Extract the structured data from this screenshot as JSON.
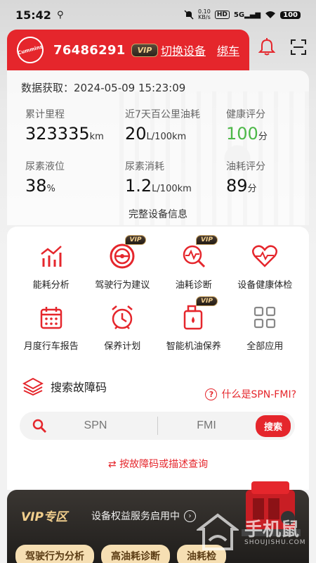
{
  "status_bar": {
    "time": "15:42",
    "usb_icon": "usb-icon",
    "net_speed_value": "0.10",
    "net_speed_unit": "KB/s",
    "hd_label": "HD",
    "signal_label": "5G",
    "battery": "100"
  },
  "header": {
    "logo_text": "Cummins",
    "device_id": "76486291",
    "vip_badge": "VIP",
    "switch_device": "切换设备",
    "bind_vehicle": "绑车",
    "accent_color": "#e5262c"
  },
  "data_card": {
    "fetch_label": "数据获取：",
    "fetch_time": "2024-05-09 15:23:09",
    "metrics": [
      {
        "label": "累计里程",
        "value": "323335",
        "unit": "km"
      },
      {
        "label": "近7天百公里油耗",
        "value": "20",
        "unit": "L/100km"
      },
      {
        "label": "健康评分",
        "value": "100",
        "unit": "分"
      },
      {
        "label": "尿素液位",
        "value": "38",
        "unit": "%"
      },
      {
        "label": "尿素消耗",
        "value": "1.2",
        "unit": "L/100km"
      },
      {
        "label": "油耗评分",
        "value": "89",
        "unit": "分"
      }
    ],
    "health_color": "#4cb848",
    "full_info_link": "完整设备信息"
  },
  "functions": [
    {
      "label": "能耗分析",
      "vip": false,
      "icon": "chart-icon"
    },
    {
      "label": "驾驶行为建议",
      "vip": true,
      "vip_label": "VIP",
      "icon": "steering-wheel-icon"
    },
    {
      "label": "油耗诊断",
      "vip": true,
      "vip_label": "VIP",
      "icon": "diagnosis-icon"
    },
    {
      "label": "设备健康体检",
      "vip": false,
      "icon": "heart-pulse-icon"
    },
    {
      "label": "月度行车报告",
      "vip": false,
      "icon": "calendar-icon"
    },
    {
      "label": "保养计划",
      "vip": false,
      "icon": "alarm-clock-icon"
    },
    {
      "label": "智能机油保养",
      "vip": true,
      "vip_label": "VIP",
      "icon": "oil-can-icon"
    },
    {
      "label": "全部应用",
      "vip": false,
      "icon": "grid-icon"
    }
  ],
  "search": {
    "title": "搜索故障码",
    "help_link": "什么是SPN-FMI?",
    "spn_placeholder": "SPN",
    "fmi_placeholder": "FMI",
    "search_button": "搜索",
    "query_link": "按故障码或描述查询"
  },
  "vip_zone": {
    "title": "VIP专区",
    "subtitle": "设备权益服务启用中",
    "pills": [
      "驾驶行为分析",
      "高油耗诊断",
      "油耗检"
    ]
  },
  "watermark": {
    "text": "手机鼠",
    "sub": "SHOUJISHU.COM"
  }
}
